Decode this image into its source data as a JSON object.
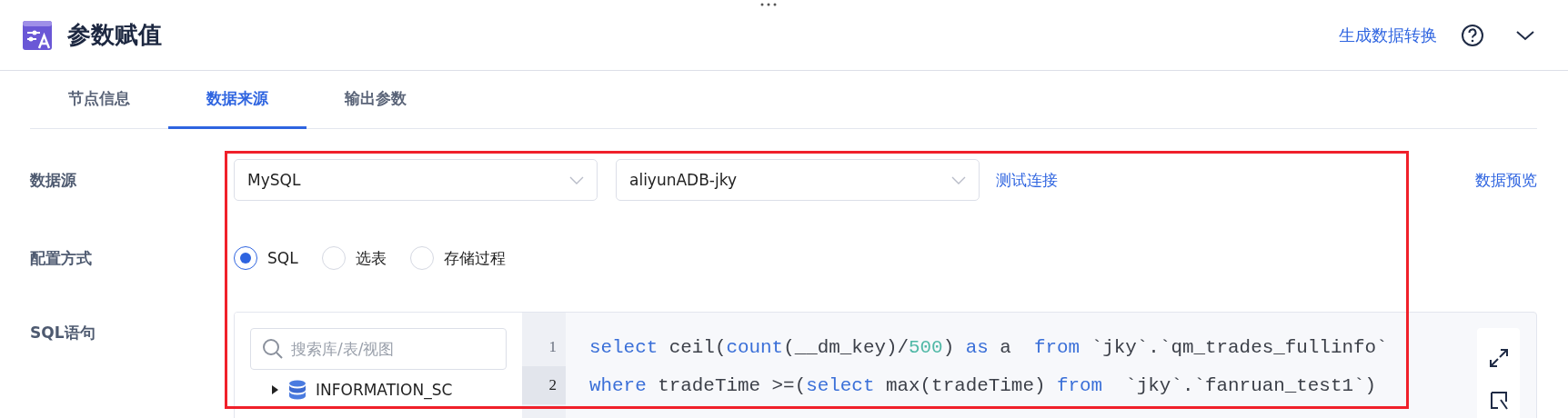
{
  "header": {
    "title": "参数赋值",
    "action_link": "生成数据转换"
  },
  "tabs": [
    {
      "label": "节点信息",
      "selected": false
    },
    {
      "label": "数据来源",
      "selected": true
    },
    {
      "label": "输出参数",
      "selected": false
    }
  ],
  "form": {
    "datasource_label": "数据源",
    "db_type": "MySQL",
    "connection": "aliyunADB-jky",
    "test_link": "测试连接",
    "preview_link": "数据预览",
    "config_label": "配置方式",
    "config_options": [
      {
        "label": "SQL",
        "selected": true
      },
      {
        "label": "选表",
        "selected": false
      },
      {
        "label": "存储过程",
        "selected": false
      }
    ],
    "sql_label": "SQL语句"
  },
  "sql_editor": {
    "search": {
      "placeholder": "搜索库/表/视图"
    },
    "tree": [
      {
        "label": "INFORMATION_SC",
        "expanded": false
      }
    ],
    "lines": [
      {
        "number": "1",
        "selected": false,
        "tokens": [
          {
            "kind": "keyword",
            "text": "select"
          },
          {
            "kind": "plain",
            "text": " ceil("
          },
          {
            "kind": "keyword",
            "text": "count"
          },
          {
            "kind": "plain",
            "text": "(__dm_key)/"
          },
          {
            "kind": "number",
            "text": "500"
          },
          {
            "kind": "plain",
            "text": ") "
          },
          {
            "kind": "keyword",
            "text": "as"
          },
          {
            "kind": "plain",
            "text": " a  "
          },
          {
            "kind": "keyword",
            "text": "from"
          },
          {
            "kind": "plain",
            "text": " `jky`.`qm_trades_fullinfo`"
          }
        ]
      },
      {
        "number": "2",
        "selected": true,
        "tokens": [
          {
            "kind": "keyword",
            "text": "where"
          },
          {
            "kind": "plain",
            "text": " tradeTime >=("
          },
          {
            "kind": "keyword",
            "text": "select"
          },
          {
            "kind": "plain",
            "text": " max(tradeTime) "
          },
          {
            "kind": "keyword",
            "text": "from"
          },
          {
            "kind": "plain",
            "text": "  `jky`.`fanruan_test1`)"
          }
        ]
      }
    ]
  }
}
